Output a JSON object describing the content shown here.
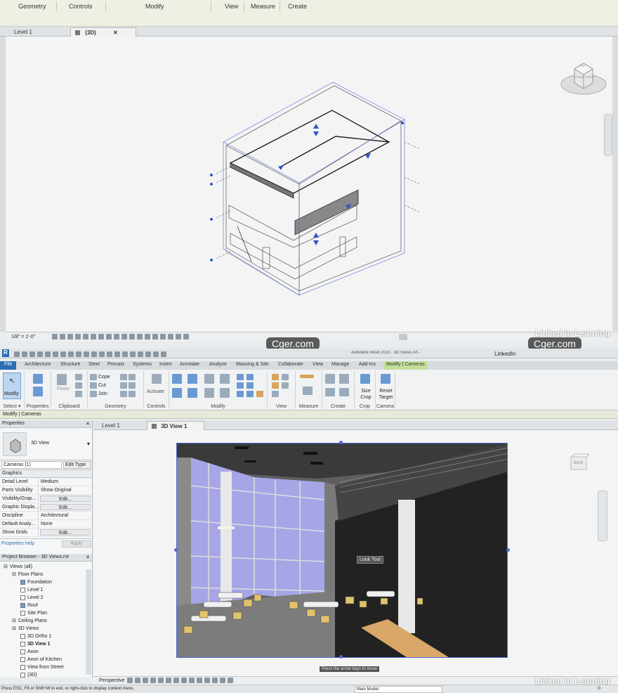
{
  "top_window": {
    "ribbon_groups": [
      "Geometry",
      "Controls",
      "Modify",
      "View",
      "Measure",
      "Create"
    ],
    "tabs": [
      {
        "label": "Level 1",
        "active": false
      },
      {
        "label": "(3D)",
        "active": true,
        "close": "✕"
      }
    ],
    "scale": "1/8\" = 1'-0\""
  },
  "watermarks": {
    "left": "Cger.com",
    "right": "Cger.com",
    "linkedin": "Linked in Learning"
  },
  "bottom_window": {
    "title": "Autodesk Revit 2023 - 3D Views.rvt - 3D View: 3D View 1",
    "user": "LinkedIn",
    "ribbon_tabs": [
      "File",
      "Architecture",
      "Structure",
      "Steel",
      "Precast",
      "Systems",
      "Insert",
      "Annotate",
      "Analyze",
      "Massing & Site",
      "Collaborate",
      "View",
      "Manage",
      "Add-Ins",
      "Modify | Cameras"
    ],
    "ribbon_groups": {
      "select": "Select",
      "select_caret": "▾",
      "properties": "Properties",
      "clipboard": "Clipboard",
      "geometry": "Geometry",
      "controls": "Controls",
      "modify": "Modify",
      "view": "View",
      "measure": "Measure",
      "create": "Create",
      "crop": "Crop",
      "camera": "Camera"
    },
    "buttons": {
      "modify": "Modify",
      "paste": "Paste",
      "cope": "Cope",
      "cut": "Cut",
      "join": "Join",
      "activate": "Activate",
      "size_crop": "Size Crop",
      "reset_target": "Reset Target"
    },
    "context_bar": "Modify | Cameras",
    "view_tabs": [
      {
        "label": "Level 1",
        "active": false
      },
      {
        "label": "3D View 1",
        "active": true,
        "close": "✕"
      }
    ],
    "properties": {
      "title": "Properties",
      "close": "✕",
      "type": "3D View",
      "selector": "Cameras (1)",
      "edit_type": "Edit Type",
      "section": "Graphics",
      "rows": [
        {
          "k": "Detail Level",
          "v": "Medium"
        },
        {
          "k": "Parts Visibility",
          "v": "Show Original"
        },
        {
          "k": "Visibility/Grap...",
          "v": "Edit...",
          "btn": true
        },
        {
          "k": "Graphic Displa...",
          "v": "Edit...",
          "btn": true
        },
        {
          "k": "Discipline",
          "v": "Architectural"
        },
        {
          "k": "Default Analy...",
          "v": "None"
        },
        {
          "k": "Show Grids",
          "v": "Edit...",
          "btn": true
        }
      ],
      "help": "Properties help",
      "apply": "Apply"
    },
    "project_browser": {
      "title": "Project Browser - 3D Views.rvt",
      "close": "✕",
      "items": [
        {
          "label": "Views (all)",
          "indent": 0
        },
        {
          "label": "Floor Plans",
          "indent": 1
        },
        {
          "label": "Foundation",
          "indent": 2,
          "check": "on"
        },
        {
          "label": "Level 1",
          "indent": 2,
          "check": "off"
        },
        {
          "label": "Level 2",
          "indent": 2,
          "check": "off"
        },
        {
          "label": "Roof",
          "indent": 2,
          "check": "on"
        },
        {
          "label": "Site Plan",
          "indent": 2,
          "check": "off"
        },
        {
          "label": "Ceiling Plans",
          "indent": 1
        },
        {
          "label": "3D Views",
          "indent": 1
        },
        {
          "label": "3D Ortho 1",
          "indent": 2,
          "check": "off"
        },
        {
          "label": "3D View 1",
          "indent": 2,
          "check": "off",
          "bold": true
        },
        {
          "label": "Axon",
          "indent": 2,
          "check": "off"
        },
        {
          "label": "Axon of Kitchen",
          "indent": 2,
          "check": "off"
        },
        {
          "label": "View from Street",
          "indent": 2,
          "check": "off"
        },
        {
          "label": "{3D}",
          "indent": 2,
          "check": "off"
        }
      ]
    },
    "tooltip": "Look Tool",
    "hint": "Press the arrow keys to move",
    "view_mode": "Perspective",
    "status": "Press ESC, F8 or Shift+W to exit, or right-click to display context menu.",
    "model": "Main Model",
    "status_right": ":0"
  },
  "viewcube": {
    "top_face": "TOP",
    "front": "FRONT",
    "right": "RIGHT",
    "back_face": "BACK"
  },
  "colors": {
    "file_tab": "#2a6db5",
    "context_tab": "#c4df9b",
    "window_glass": "#a6a6e6",
    "chair": "#e0c36a"
  }
}
